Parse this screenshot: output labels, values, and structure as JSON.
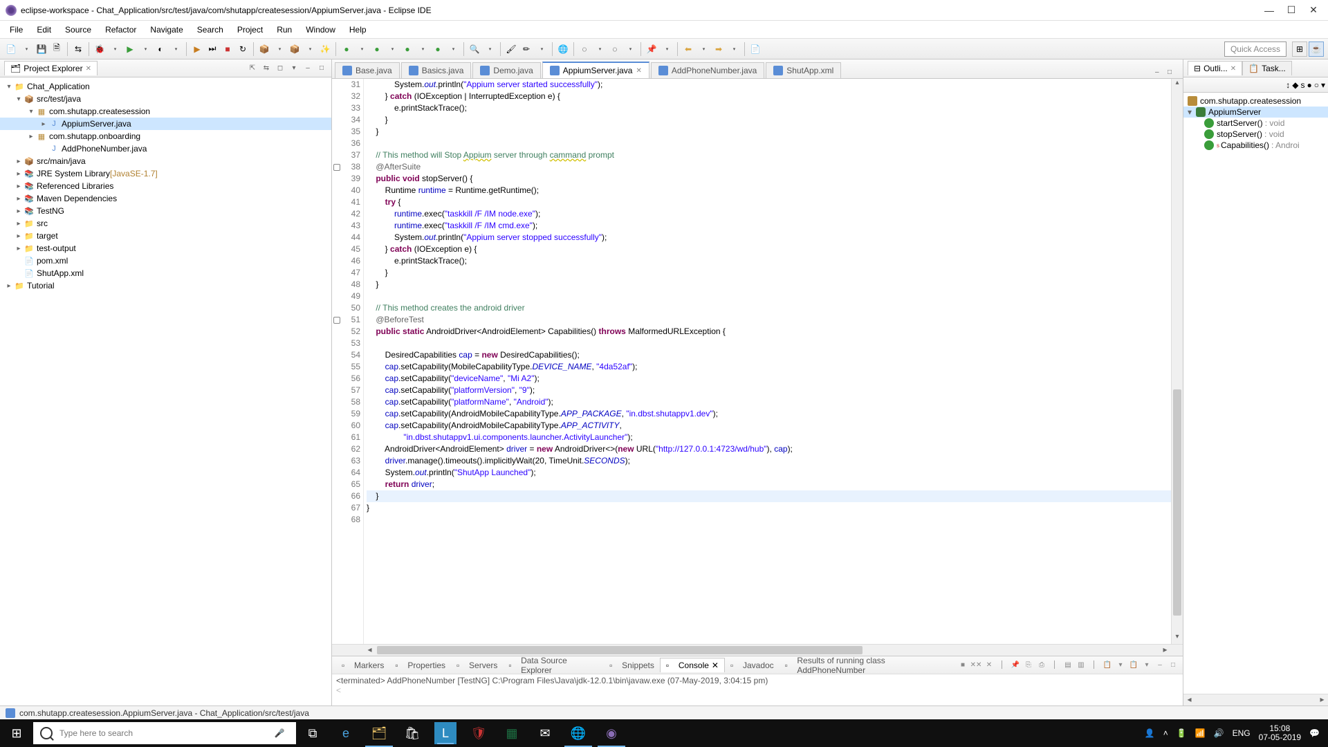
{
  "window": {
    "title": "eclipse-workspace - Chat_Application/src/test/java/com/shutapp/createsession/AppiumServer.java - Eclipse IDE"
  },
  "menu": [
    "File",
    "Edit",
    "Source",
    "Refactor",
    "Navigate",
    "Search",
    "Project",
    "Run",
    "Window",
    "Help"
  ],
  "quick_access": "Quick Access",
  "project_explorer": {
    "title": "Project Explorer",
    "tree": [
      {
        "level": 0,
        "expand": "▾",
        "icon": "📁",
        "label": "Chat_Application",
        "cls": "folder-icon"
      },
      {
        "level": 1,
        "expand": "▾",
        "icon": "📦",
        "label": "src/test/java",
        "cls": "pkg-icon"
      },
      {
        "level": 2,
        "expand": "▾",
        "icon": "▦",
        "label": "com.shutapp.createsession",
        "cls": "pkg-icon"
      },
      {
        "level": 3,
        "expand": "▸",
        "icon": "J",
        "label": "AppiumServer.java",
        "cls": "java-icon",
        "selected": true
      },
      {
        "level": 2,
        "expand": "▸",
        "icon": "▦",
        "label": "com.shutapp.onboarding",
        "cls": "pkg-icon"
      },
      {
        "level": 3,
        "expand": "",
        "icon": "J",
        "label": "AddPhoneNumber.java",
        "cls": "java-icon"
      },
      {
        "level": 1,
        "expand": "▸",
        "icon": "📦",
        "label": "src/main/java",
        "cls": "pkg-icon"
      },
      {
        "level": 1,
        "expand": "▸",
        "icon": "📚",
        "label": "JRE System Library",
        "extra": "[JavaSE-1.7]",
        "cls": "lib-icon"
      },
      {
        "level": 1,
        "expand": "▸",
        "icon": "📚",
        "label": "Referenced Libraries",
        "cls": "lib-icon"
      },
      {
        "level": 1,
        "expand": "▸",
        "icon": "📚",
        "label": "Maven Dependencies",
        "cls": "lib-icon"
      },
      {
        "level": 1,
        "expand": "▸",
        "icon": "📚",
        "label": "TestNG",
        "cls": "lib-icon"
      },
      {
        "level": 1,
        "expand": "▸",
        "icon": "📁",
        "label": "src",
        "cls": "folder-icon"
      },
      {
        "level": 1,
        "expand": "▸",
        "icon": "📁",
        "label": "target",
        "cls": "folder-icon"
      },
      {
        "level": 1,
        "expand": "▸",
        "icon": "📁",
        "label": "test-output",
        "cls": "folder-icon"
      },
      {
        "level": 1,
        "expand": "",
        "icon": "📄",
        "label": "pom.xml",
        "cls": ""
      },
      {
        "level": 1,
        "expand": "",
        "icon": "📄",
        "label": "ShutApp.xml",
        "cls": ""
      },
      {
        "level": 0,
        "expand": "▸",
        "icon": "📁",
        "label": "Tutorial",
        "cls": "folder-icon"
      }
    ]
  },
  "editor_tabs": [
    {
      "label": "Base.java"
    },
    {
      "label": "Basics.java"
    },
    {
      "label": "Demo.java"
    },
    {
      "label": "AppiumServer.java",
      "active": true,
      "x": true
    },
    {
      "label": "AddPhoneNumber.java"
    },
    {
      "label": "ShutApp.xml"
    }
  ],
  "code_lines": [
    {
      "n": 31,
      "html": "            System.<span class='fi'>out</span>.println(<span class='s'>\"Appium server started successfully\"</span>);"
    },
    {
      "n": 32,
      "html": "        } <span class='k'>catch</span> (IOException | InterruptedException e) {"
    },
    {
      "n": 33,
      "html": "            e.printStackTrace();"
    },
    {
      "n": 34,
      "html": "        }"
    },
    {
      "n": 35,
      "html": "    }"
    },
    {
      "n": 36,
      "html": ""
    },
    {
      "n": 37,
      "html": "    <span class='c'>// This method will Stop <span class='w'>Appium</span> server through <span class='w'>cammand</span> prompt</span>"
    },
    {
      "n": 38,
      "mark": true,
      "html": "    <span class='a'>@AfterSuite</span>"
    },
    {
      "n": 39,
      "html": "    <span class='k'>public</span> <span class='k'>void</span> stopServer() {"
    },
    {
      "n": 40,
      "html": "        Runtime <span class='f'>runtime</span> = Runtime.<span>getRuntime</span>();"
    },
    {
      "n": 41,
      "html": "        <span class='k'>try</span> {"
    },
    {
      "n": 42,
      "html": "            <span class='f'>runtime</span>.exec(<span class='s'>\"taskkill /F /IM node.exe\"</span>);"
    },
    {
      "n": 43,
      "html": "            <span class='f'>runtime</span>.exec(<span class='s'>\"taskkill /F /IM cmd.exe\"</span>);"
    },
    {
      "n": 44,
      "html": "            System.<span class='fi'>out</span>.println(<span class='s'>\"Appium server stopped successfully\"</span>);"
    },
    {
      "n": 45,
      "html": "        } <span class='k'>catch</span> (IOException e) {"
    },
    {
      "n": 46,
      "html": "            e.printStackTrace();"
    },
    {
      "n": 47,
      "html": "        }"
    },
    {
      "n": 48,
      "html": "    }"
    },
    {
      "n": 49,
      "html": ""
    },
    {
      "n": 50,
      "html": "    <span class='c'>// This method creates the android driver</span>"
    },
    {
      "n": 51,
      "mark": true,
      "html": "    <span class='a'>@BeforeTest</span>"
    },
    {
      "n": 52,
      "html": "    <span class='k'>public</span> <span class='k'>static</span> AndroidDriver&lt;AndroidElement&gt; Capabilities() <span class='k'>throws</span> MalformedURLException {"
    },
    {
      "n": 53,
      "html": ""
    },
    {
      "n": 54,
      "html": "        DesiredCapabilities <span class='f'>cap</span> = <span class='k'>new</span> DesiredCapabilities();"
    },
    {
      "n": 55,
      "html": "        <span class='f'>cap</span>.setCapability(MobileCapabilityType.<span class='fi'>DEVICE_NAME</span>, <span class='s'>\"4da52af\"</span>);"
    },
    {
      "n": 56,
      "html": "        <span class='f'>cap</span>.setCapability(<span class='s'>\"deviceName\"</span>, <span class='s'>\"Mi A2\"</span>);"
    },
    {
      "n": 57,
      "html": "        <span class='f'>cap</span>.setCapability(<span class='s'>\"platformVersion\"</span>, <span class='s'>\"9\"</span>);"
    },
    {
      "n": 58,
      "html": "        <span class='f'>cap</span>.setCapability(<span class='s'>\"platformName\"</span>, <span class='s'>\"Android\"</span>);"
    },
    {
      "n": 59,
      "html": "        <span class='f'>cap</span>.setCapability(AndroidMobileCapabilityType.<span class='fi'>APP_PACKAGE</span>, <span class='s'>\"in.dbst.shutappv1.dev\"</span>);"
    },
    {
      "n": 60,
      "html": "        <span class='f'>cap</span>.setCapability(AndroidMobileCapabilityType.<span class='fi'>APP_ACTIVITY</span>,"
    },
    {
      "n": 61,
      "html": "                <span class='s'>\"in.dbst.shutappv1.ui.components.launcher.ActivityLauncher\"</span>);"
    },
    {
      "n": 62,
      "html": "        AndroidDriver&lt;AndroidElement&gt; <span class='f'>driver</span> = <span class='k'>new</span> AndroidDriver&lt;&gt;(<span class='k'>new</span> URL(<span class='s'>\"http://127.0.0.1:4723/wd/hub\"</span>), <span class='f'>cap</span>);"
    },
    {
      "n": 63,
      "html": "        <span class='f'>driver</span>.manage().timeouts().implicitlyWait(20, TimeUnit.<span class='fi'>SECONDS</span>);"
    },
    {
      "n": 64,
      "html": "        System.<span class='fi'>out</span>.println(<span class='s'>\"ShutApp Launched\"</span>);"
    },
    {
      "n": 65,
      "html": "        <span class='k'>return</span> <span class='f'>driver</span>;"
    },
    {
      "n": 66,
      "hl": true,
      "html": "    }"
    },
    {
      "n": 67,
      "html": "}"
    },
    {
      "n": 68,
      "html": ""
    }
  ],
  "outline": {
    "tab1": "Outli...",
    "tab2": "Task...",
    "pkg": "com.shutapp.createsession",
    "cls": "AppiumServer",
    "methods": [
      {
        "name": "startServer()",
        "ret": ": void"
      },
      {
        "name": "stopServer()",
        "ret": ": void"
      },
      {
        "name": "Capabilities()",
        "ret": ": Androi",
        "static": true
      }
    ]
  },
  "bottom_tabs": [
    {
      "label": "Markers"
    },
    {
      "label": "Properties"
    },
    {
      "label": "Servers"
    },
    {
      "label": "Data Source Explorer"
    },
    {
      "label": "Snippets"
    },
    {
      "label": "Console",
      "active": true,
      "x": true
    },
    {
      "label": "Javadoc"
    },
    {
      "label": "Results of running class AddPhoneNumber"
    }
  ],
  "console_line": "<terminated> AddPhoneNumber [TestNG] C:\\Program Files\\Java\\jdk-12.0.1\\bin\\javaw.exe (07-May-2019, 3:04:15 pm)",
  "status": "com.shutapp.createsession.AppiumServer.java - Chat_Application/src/test/java",
  "taskbar": {
    "search_placeholder": "Type here to search",
    "lang": "ENG",
    "time": "15:08",
    "date": "07-05-2019"
  }
}
